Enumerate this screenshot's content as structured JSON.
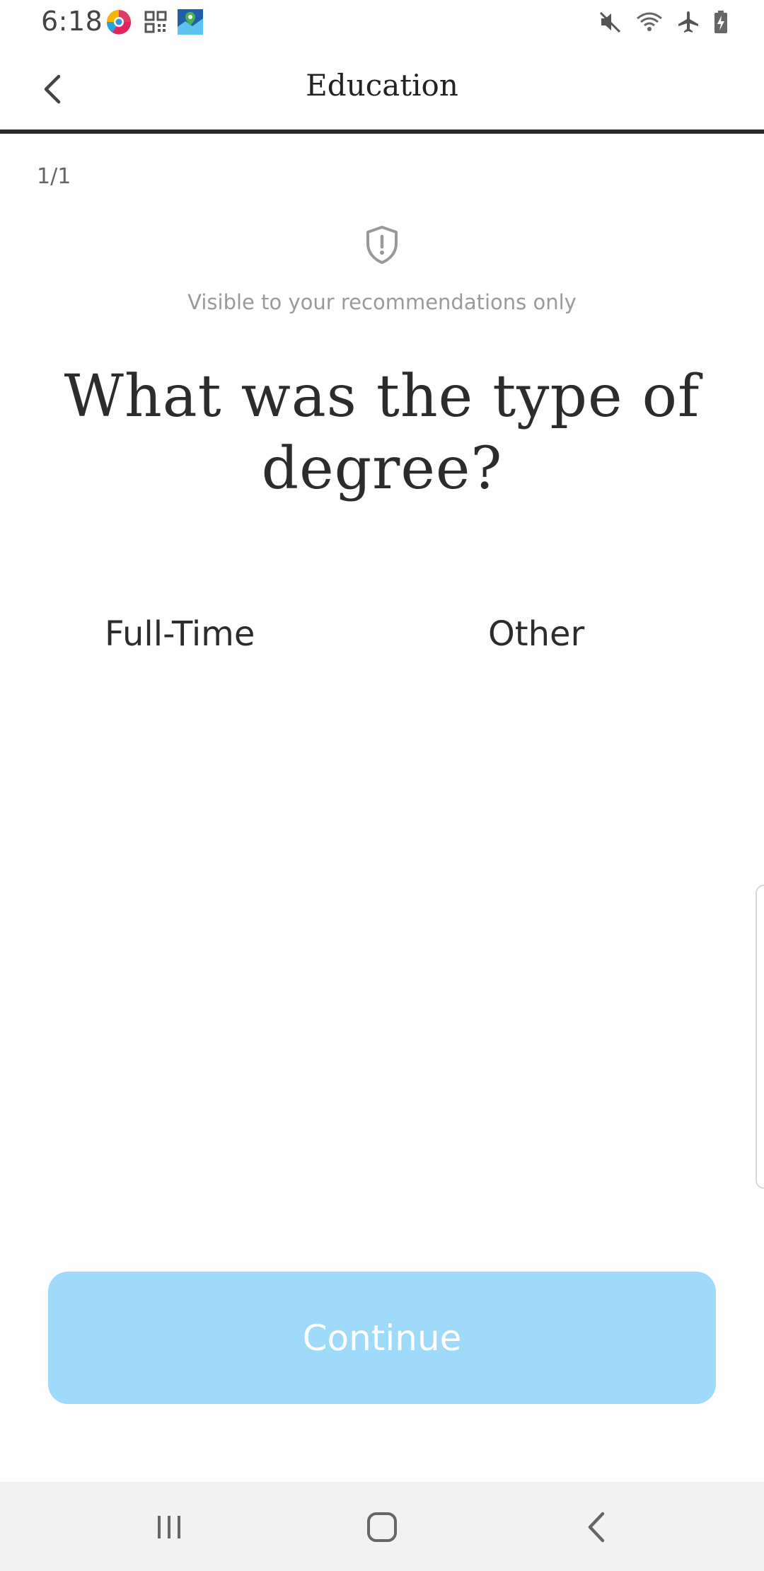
{
  "status_bar": {
    "time": "6:18",
    "app_icons": [
      "chrome-like-app-icon",
      "qr-code-icon",
      "maps-app-icon"
    ],
    "right_icons": [
      "mute-icon",
      "wifi-icon",
      "airplane-mode-icon",
      "battery-charging-icon"
    ]
  },
  "header": {
    "title": "Education",
    "back_icon": "chevron-left-icon"
  },
  "progress": "1/1",
  "privacy": {
    "icon": "shield-alert-icon",
    "text": "Visible to your recommendations only"
  },
  "question": "What was the type of degree?",
  "options": [
    {
      "label": "Full-Time"
    },
    {
      "label": "Other"
    }
  ],
  "continue_button": {
    "label": "Continue",
    "color": "#9fdafa"
  },
  "nav_bar": {
    "icons": [
      "recents-icon",
      "home-icon",
      "back-icon"
    ]
  }
}
